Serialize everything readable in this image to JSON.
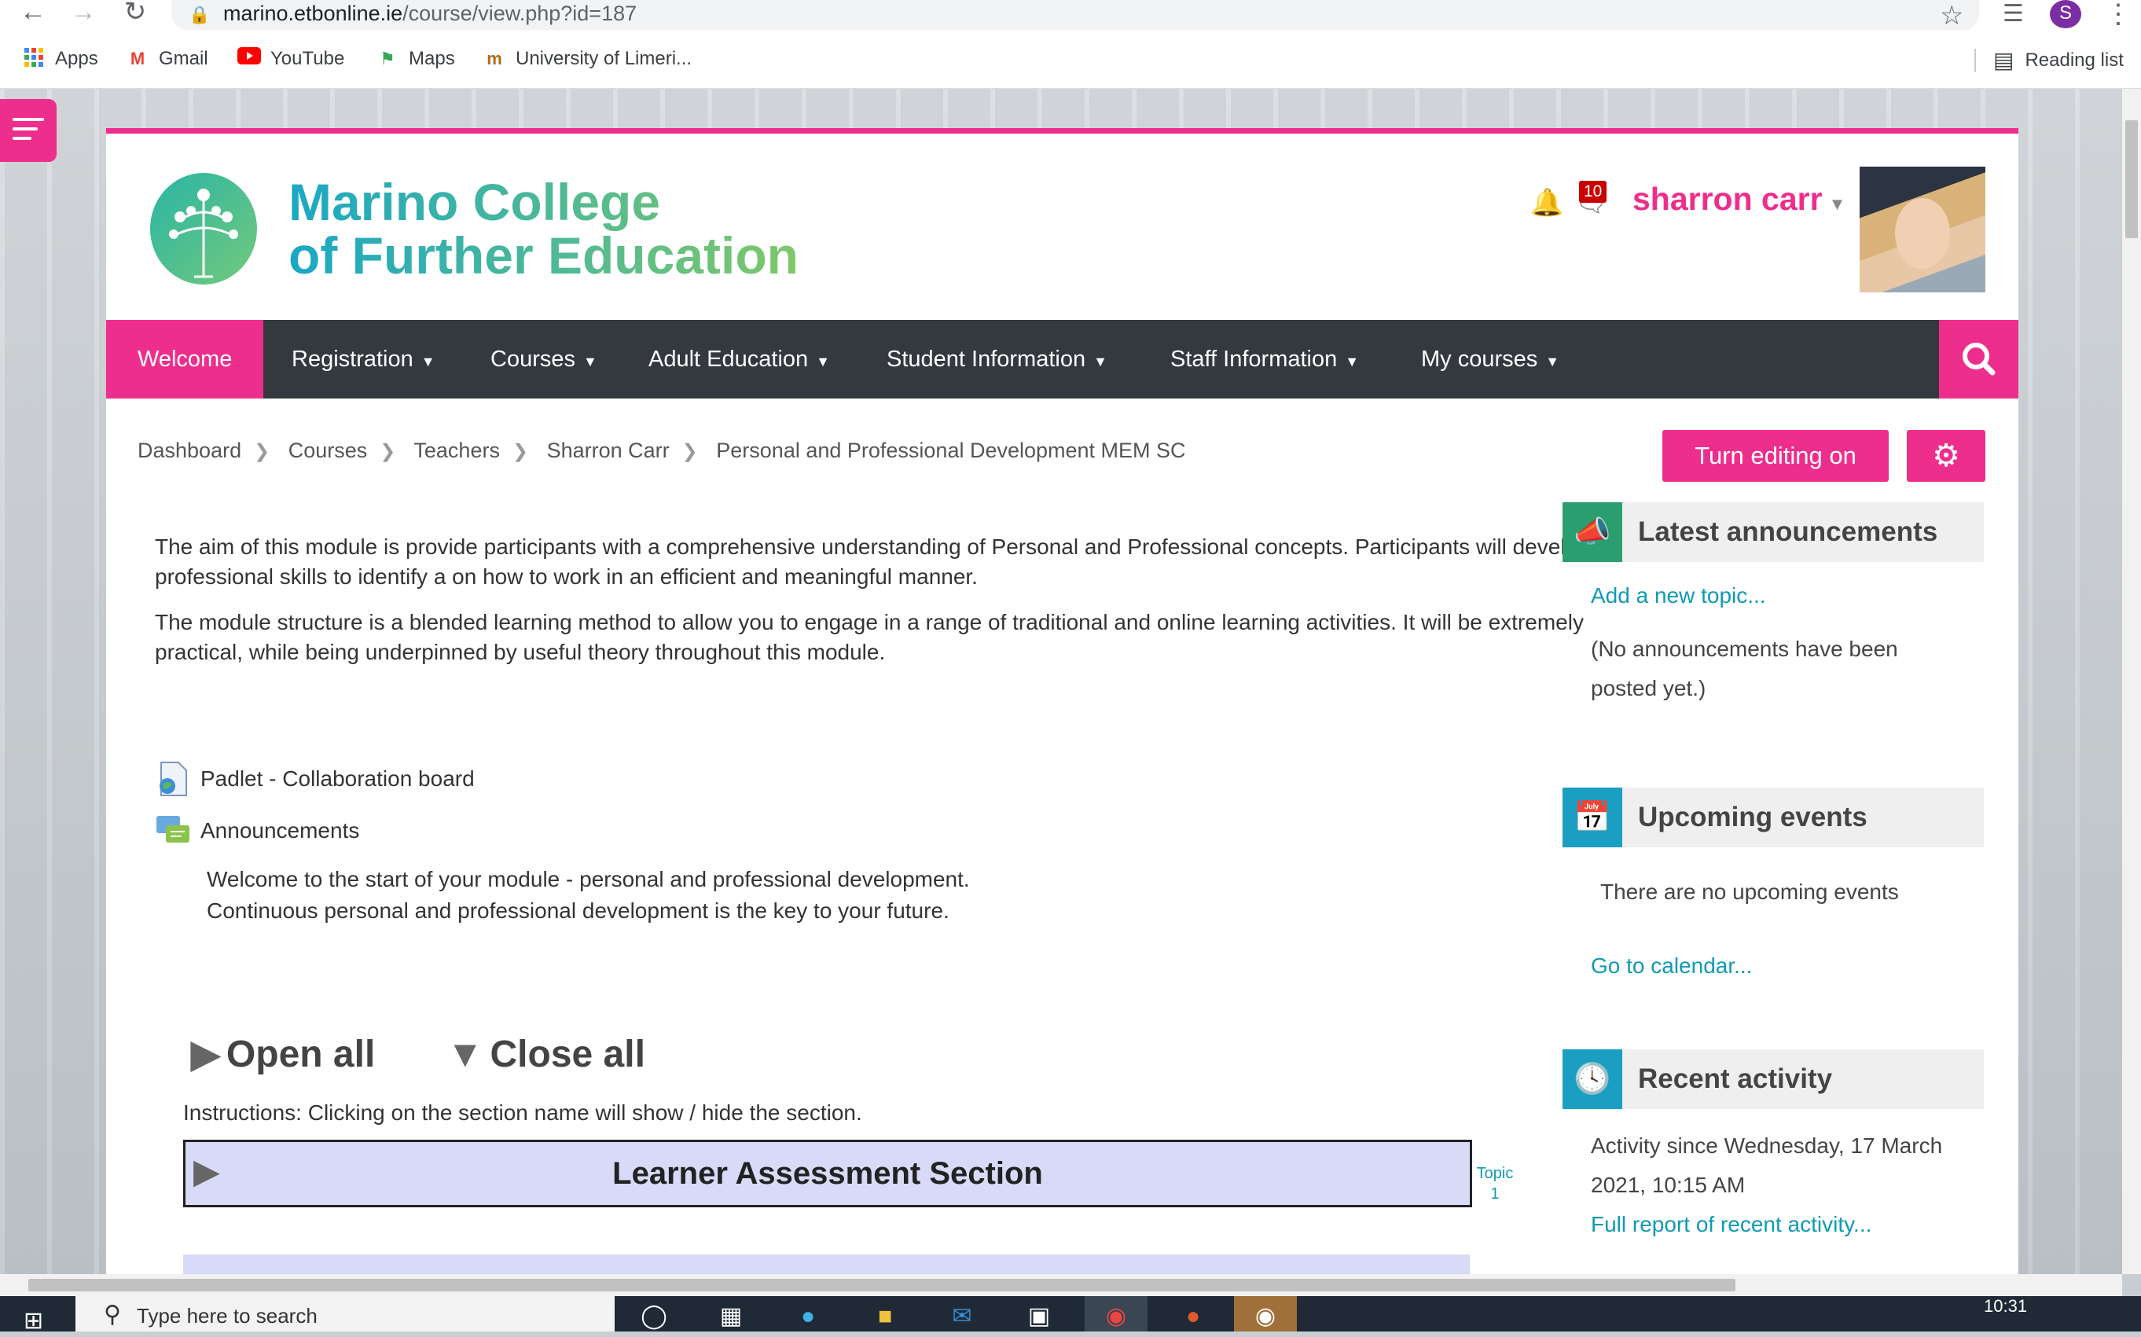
{
  "browser": {
    "url_host": "marino.etbonline.ie",
    "url_path": "/course/view.php?id=187",
    "profile_initial": "S",
    "bookmarks": [
      {
        "label": "Apps",
        "icon": "apps-grid-icon"
      },
      {
        "label": "Gmail",
        "icon": "gmail-icon"
      },
      {
        "label": "YouTube",
        "icon": "youtube-icon"
      },
      {
        "label": "Maps",
        "icon": "maps-icon"
      },
      {
        "label": "University of Limeri...",
        "icon": "university-icon"
      }
    ],
    "reading_list": "Reading list"
  },
  "header": {
    "logo_line1": "Marino College",
    "logo_line2": "of Further Education",
    "notification_count": "10",
    "user_name": "sharron carr"
  },
  "menu": {
    "items": [
      "Welcome",
      "Registration",
      "Courses",
      "Adult Education",
      "Student Information",
      "Staff Information",
      "My courses"
    ]
  },
  "breadcrumb": [
    "Dashboard",
    "Courses",
    "Teachers",
    "Sharron Carr",
    "Personal and Professional Development MEM SC"
  ],
  "actions": {
    "edit_label": "Turn editing on"
  },
  "intro": {
    "p1": "The aim of this module is provide participants with a comprehensive understanding of Personal and Professional concepts. Participants will develop professional skills to identify a on how to work in an efficient and meaningful manner.",
    "p2": "The module structure is a blended learning method to allow you to engage in a range of traditional and online learning activities. It will be extremely practical, while being underpinned by useful theory throughout this module."
  },
  "activities": {
    "padlet": "Padlet - Collaboration board",
    "announcements": "Announcements",
    "ann_line1": "Welcome to the start of your module - personal and professional development.",
    "ann_line2": "Continuous personal and professional development is the key to your future."
  },
  "sections": {
    "open_all": "Open all",
    "close_all": "Close all",
    "instructions": "Instructions: Clicking on the section name will show / hide the section.",
    "section1_title": "Learner Assessment Section",
    "topic_label": "Topic",
    "topic_number": "1"
  },
  "blocks": {
    "announcements": {
      "title": "Latest announcements",
      "add_link": "Add a new topic...",
      "empty_text": "(No announcements have been posted yet.)"
    },
    "events": {
      "title": "Upcoming events",
      "empty_text": "There are no upcoming events",
      "calendar_link": "Go to calendar..."
    },
    "recent": {
      "title": "Recent activity",
      "since_text": "Activity since Wednesday, 17 March 2021, 10:15 AM",
      "report_link": "Full report of recent activity..."
    }
  },
  "taskbar": {
    "search_placeholder": "Type here to search",
    "clock": "10:31"
  },
  "colors": {
    "brand_pink": "#ee2e8c",
    "menu_dark": "#34393f",
    "block_icon_blue": "#1a9fc2",
    "link": "#0f9ab4",
    "section_bg": "#d8daf7"
  }
}
